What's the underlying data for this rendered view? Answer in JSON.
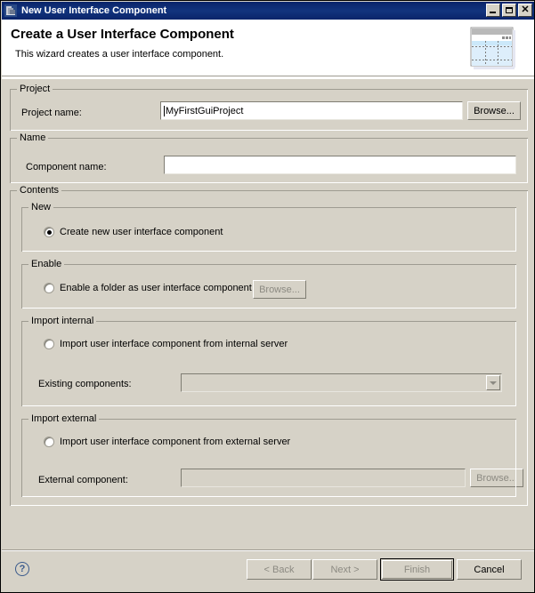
{
  "window": {
    "title": "New User Interface Component",
    "titlebar_buttons": {
      "minimize": "_",
      "maximize": "□",
      "close": "✕"
    }
  },
  "header": {
    "title": "Create a User Interface Component",
    "description": "This wizard creates a user interface component."
  },
  "project_group": {
    "legend": "Project",
    "project_name_label": "Project name:",
    "project_name_value": "MyFirstGuiProject",
    "browse_label": "Browse..."
  },
  "name_group": {
    "legend": "Name",
    "component_name_label": "Component name:",
    "component_name_value": ""
  },
  "contents_group": {
    "legend": "Contents",
    "new_group": {
      "legend": "New",
      "radio_label": "Create new user interface component"
    },
    "enable_group": {
      "legend": "Enable",
      "radio_label": "Enable a folder as user interface component",
      "browse_label": "Browse..."
    },
    "import_internal_group": {
      "legend": "Import internal",
      "radio_label": "Import user interface component from internal server",
      "existing_components_label": "Existing components:",
      "existing_components_value": ""
    },
    "import_external_group": {
      "legend": "Import external",
      "radio_label": "Import user interface component from external server",
      "external_component_label": "External component:",
      "external_component_value": "",
      "browse_label": "Browse..."
    }
  },
  "footer": {
    "help_glyph": "?",
    "back_label": "< Back",
    "next_label": "Next >",
    "finish_label": "Finish",
    "cancel_label": "Cancel"
  },
  "colors": {
    "titlebar": "#0a246a",
    "dialog_background": "#d6d2c7",
    "header_background": "#ffffff",
    "group_border": "#9e9b91",
    "disabled_text": "#8c8a82",
    "help_blue": "#3a5a8c"
  }
}
